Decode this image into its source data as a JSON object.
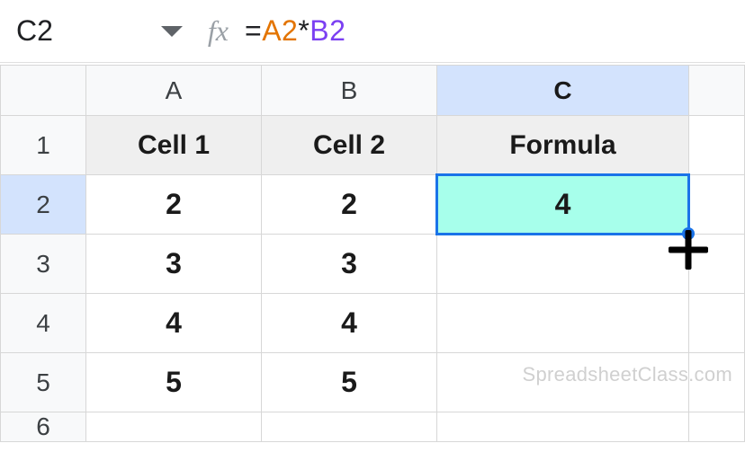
{
  "formula_bar": {
    "cell_ref": "C2",
    "fx_label": "fx",
    "equals": "=",
    "ref1": "A2",
    "operator": "*",
    "ref2": "B2"
  },
  "columns": {
    "a": "A",
    "b": "B",
    "c": "C"
  },
  "row_labels": [
    "1",
    "2",
    "3",
    "4",
    "5",
    "6"
  ],
  "headers": {
    "cell1": "Cell 1",
    "cell2": "Cell 2",
    "formula": "Formula"
  },
  "data": {
    "r2": {
      "a": "2",
      "b": "2",
      "c": "4"
    },
    "r3": {
      "a": "3",
      "b": "3",
      "c": ""
    },
    "r4": {
      "a": "4",
      "b": "4",
      "c": ""
    },
    "r5": {
      "a": "5",
      "b": "5",
      "c": ""
    }
  },
  "watermark": "SpreadsheetClass.com"
}
